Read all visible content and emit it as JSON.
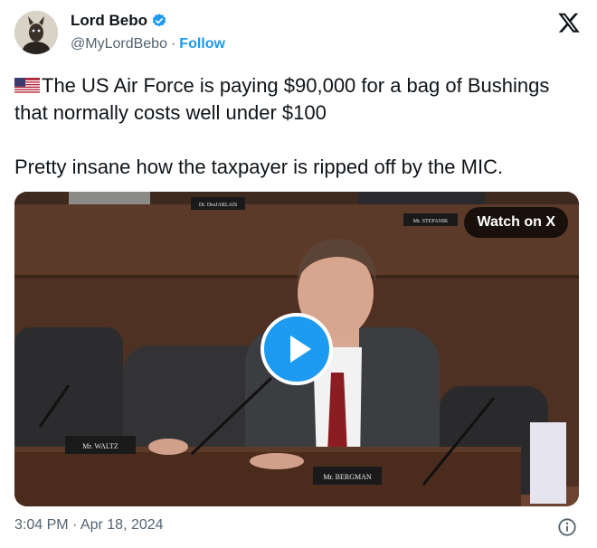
{
  "author": {
    "name": "Lord Bebo",
    "handle": "@MyLordBebo",
    "separator": "·",
    "follow_label": "Follow"
  },
  "tweet": {
    "text_line1": "The US Air Force is paying $90,000 for a bag of Bushings that normally costs well under $100",
    "text_line2": "Pretty insane how the taxpayer is ripped off by the MIC.",
    "flag_icon": "us-flag"
  },
  "media": {
    "watch_label": "Watch on X",
    "nameplates": {
      "top_left": "Dr. DesJARLAIS",
      "top_right": "Mr. STEFANIK",
      "waltz": "Mr. WALTZ",
      "bergman": "Mr. BERGMAN"
    }
  },
  "footer": {
    "timestamp": "3:04 PM · Apr 18, 2024"
  },
  "colors": {
    "accent": "#1d9bf0",
    "text": "#0f1419",
    "muted": "#536471"
  }
}
